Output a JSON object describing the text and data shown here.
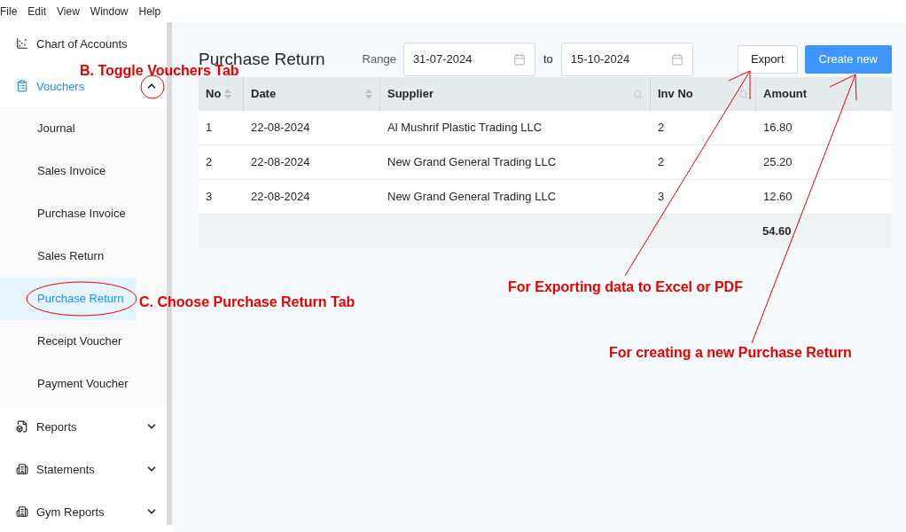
{
  "menu_bar": [
    "File",
    "Edit",
    "View",
    "Window",
    "Help"
  ],
  "sidebar": {
    "items": [
      {
        "label": "Chart of Accounts",
        "selected": false
      },
      {
        "label": "Vouchers",
        "selected": true,
        "expanded": true,
        "children": [
          {
            "label": "Journal",
            "selected": false
          },
          {
            "label": "Sales Invoice",
            "selected": false
          },
          {
            "label": "Purchase Invoice",
            "selected": false
          },
          {
            "label": "Sales Return",
            "selected": false
          },
          {
            "label": "Purchase Return",
            "selected": true
          },
          {
            "label": "Receipt Voucher",
            "selected": false
          },
          {
            "label": "Payment Voucher",
            "selected": false
          }
        ]
      },
      {
        "label": "Reports",
        "selected": false,
        "expanded": false
      },
      {
        "label": "Statements",
        "selected": false,
        "expanded": false
      },
      {
        "label": "Gym Reports",
        "selected": false,
        "expanded": false
      }
    ]
  },
  "page_title": "Purchase Return",
  "range": {
    "label": "Range",
    "from": "31-07-2024",
    "separator": "to",
    "to": "15-10-2024"
  },
  "buttons": [
    {
      "label": "Export",
      "kind": "outline"
    },
    {
      "label": "Create new",
      "kind": "primary"
    }
  ],
  "table": {
    "columns": [
      {
        "label": "No",
        "kind": "sort"
      },
      {
        "label": "Date",
        "kind": "sort"
      },
      {
        "label": "Supplier",
        "kind": "search"
      },
      {
        "label": "Inv No",
        "kind": "search"
      },
      {
        "label": "Amount",
        "kind": "plain"
      }
    ],
    "rows": [
      [
        "1",
        "22-08-2024",
        "Al Mushrif Plastic Trading LLC",
        "2",
        "16.80"
      ],
      [
        "2",
        "22-08-2024",
        "New Grand General Trading LLC",
        "2",
        "25.20"
      ],
      [
        "3",
        "22-08-2024",
        "New Grand General Trading LLC",
        "3",
        "12.60"
      ]
    ],
    "total": "54.60"
  },
  "annotations": [
    "B. Toggle Vouchers Tab",
    "C. Choose Purchase Return Tab",
    "For Exporting data to Excel or PDF",
    "For creating a new Purchase Return"
  ]
}
